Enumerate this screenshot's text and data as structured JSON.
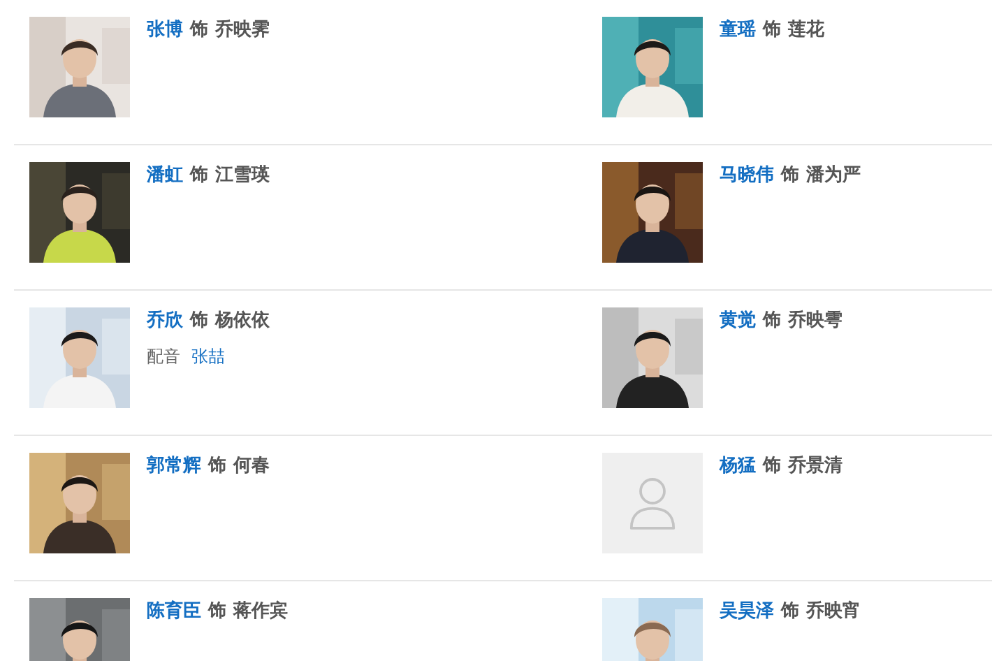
{
  "cast": [
    {
      "actor": "张博",
      "connector": "饰",
      "role": "乔映霁"
    },
    {
      "actor": "童瑶",
      "connector": "饰",
      "role": "莲花"
    },
    {
      "actor": "潘虹",
      "connector": "饰",
      "role": "江雪瑛"
    },
    {
      "actor": "马晓伟",
      "connector": "饰",
      "role": "潘为严"
    },
    {
      "actor": "乔欣",
      "connector": "饰",
      "role": "杨依依",
      "voice": {
        "label": "配音",
        "actor": "张喆"
      }
    },
    {
      "actor": "黄觉",
      "connector": "饰",
      "role": "乔映雩"
    },
    {
      "actor": "郭常辉",
      "connector": "饰",
      "role": "何春"
    },
    {
      "actor": "杨猛",
      "connector": "饰",
      "role": "乔景清",
      "photo": {
        "kind": "placeholder"
      }
    },
    {
      "actor": "陈育臣",
      "connector": "饰",
      "role": "蒋作宾"
    },
    {
      "actor": "吴昊泽",
      "connector": "饰",
      "role": "乔映宵"
    }
  ]
}
